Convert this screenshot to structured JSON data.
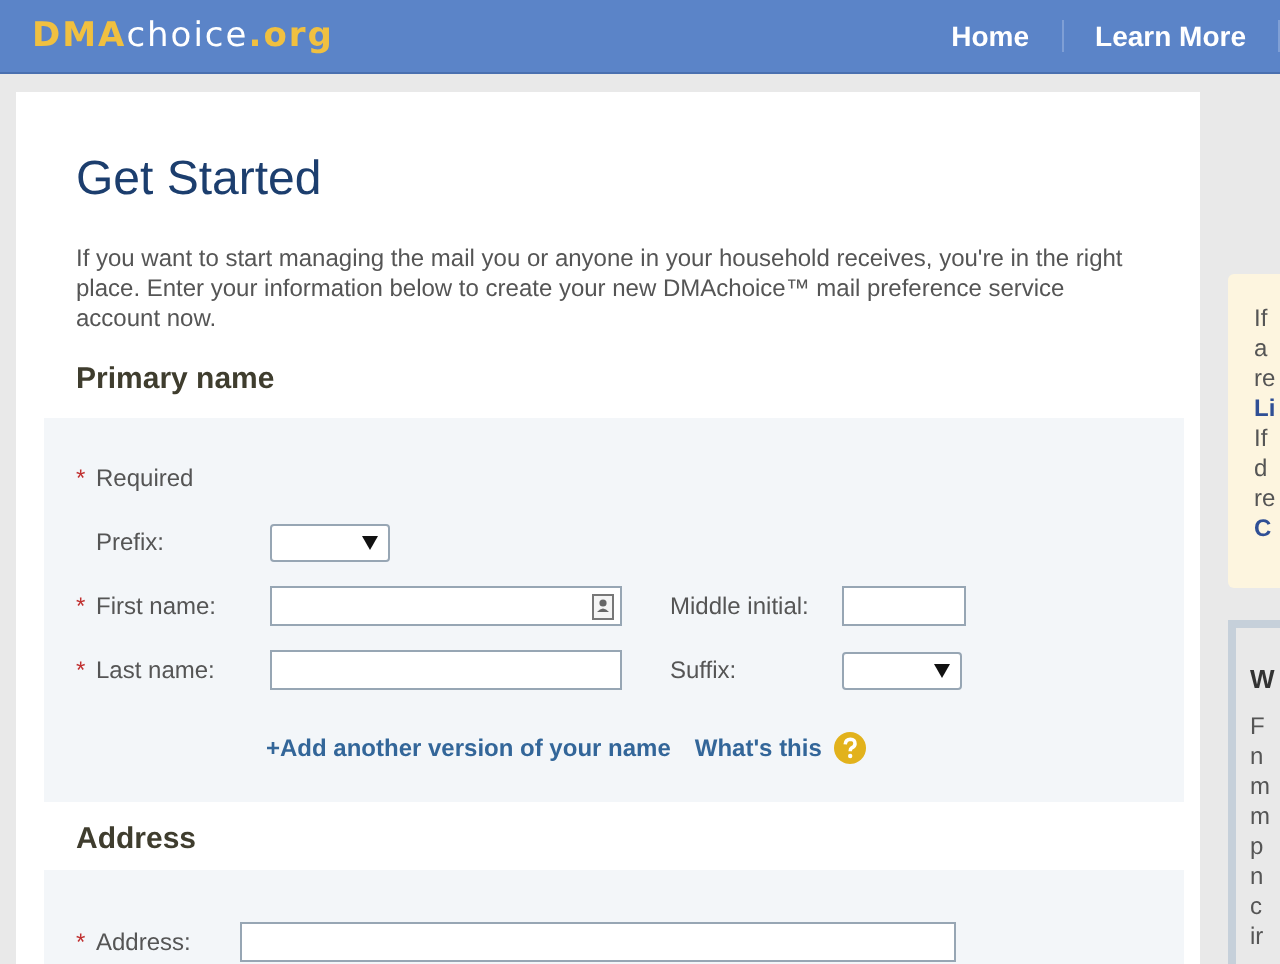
{
  "header": {
    "logo": [
      {
        "text": "DMA",
        "kind": "accent"
      },
      {
        "text": "choice",
        "kind": "plain"
      },
      {
        "text": ".org",
        "kind": "accent"
      }
    ],
    "nav": [
      {
        "label": "Home"
      },
      {
        "label": "Learn More"
      }
    ]
  },
  "title": "Get Started",
  "intro": "If you want to start managing the mail you or anyone in your household receives, you're in the right place. Enter your information below to create your new DMAchoice™ mail preference service account now.",
  "required_mark": "*",
  "sections": [
    {
      "heading": "Primary name",
      "kind": "name",
      "required_note": "Required",
      "rows": [
        {
          "fields": [
            {
              "label": "Prefix:",
              "required": false,
              "kind": "select"
            }
          ]
        },
        {
          "fields": [
            {
              "label": "First name:",
              "required": true,
              "kind": "text",
              "contact_icon": true
            },
            {
              "label": "Middle initial:",
              "required": false,
              "kind": "short"
            }
          ]
        },
        {
          "fields": [
            {
              "label": "Last name:",
              "required": true,
              "kind": "text",
              "contact_icon": false
            },
            {
              "label": "Suffix:",
              "required": false,
              "kind": "select"
            }
          ]
        }
      ],
      "links": [
        {
          "text": "+Add another version of your name",
          "help": false
        },
        {
          "text": "What's this",
          "help": true
        }
      ]
    },
    {
      "heading": "Address",
      "kind": "address",
      "rows": [
        {
          "fields": [
            {
              "label": "Address:",
              "required": true,
              "kind": "wide"
            }
          ]
        }
      ]
    }
  ],
  "sidebar": [
    {
      "kind": "note",
      "lines": [
        {
          "text": "If",
          "link": false
        },
        {
          "text": "a",
          "link": false
        },
        {
          "text": "re",
          "link": false
        },
        {
          "text": "Li",
          "link": true
        },
        {
          "text": "If",
          "link": false
        },
        {
          "text": "d",
          "link": false
        },
        {
          "text": "re",
          "link": false
        },
        {
          "text": "C",
          "link": true
        }
      ]
    },
    {
      "kind": "box",
      "heading": "W",
      "lines": [
        {
          "text": "F",
          "link": false
        },
        {
          "text": "n",
          "link": false
        },
        {
          "text": "m",
          "link": false
        },
        {
          "text": "m",
          "link": false
        },
        {
          "text": "p",
          "link": false
        },
        {
          "text": "n",
          "link": false
        },
        {
          "text": "c",
          "link": false
        },
        {
          "text": "ir",
          "link": false
        }
      ]
    }
  ]
}
